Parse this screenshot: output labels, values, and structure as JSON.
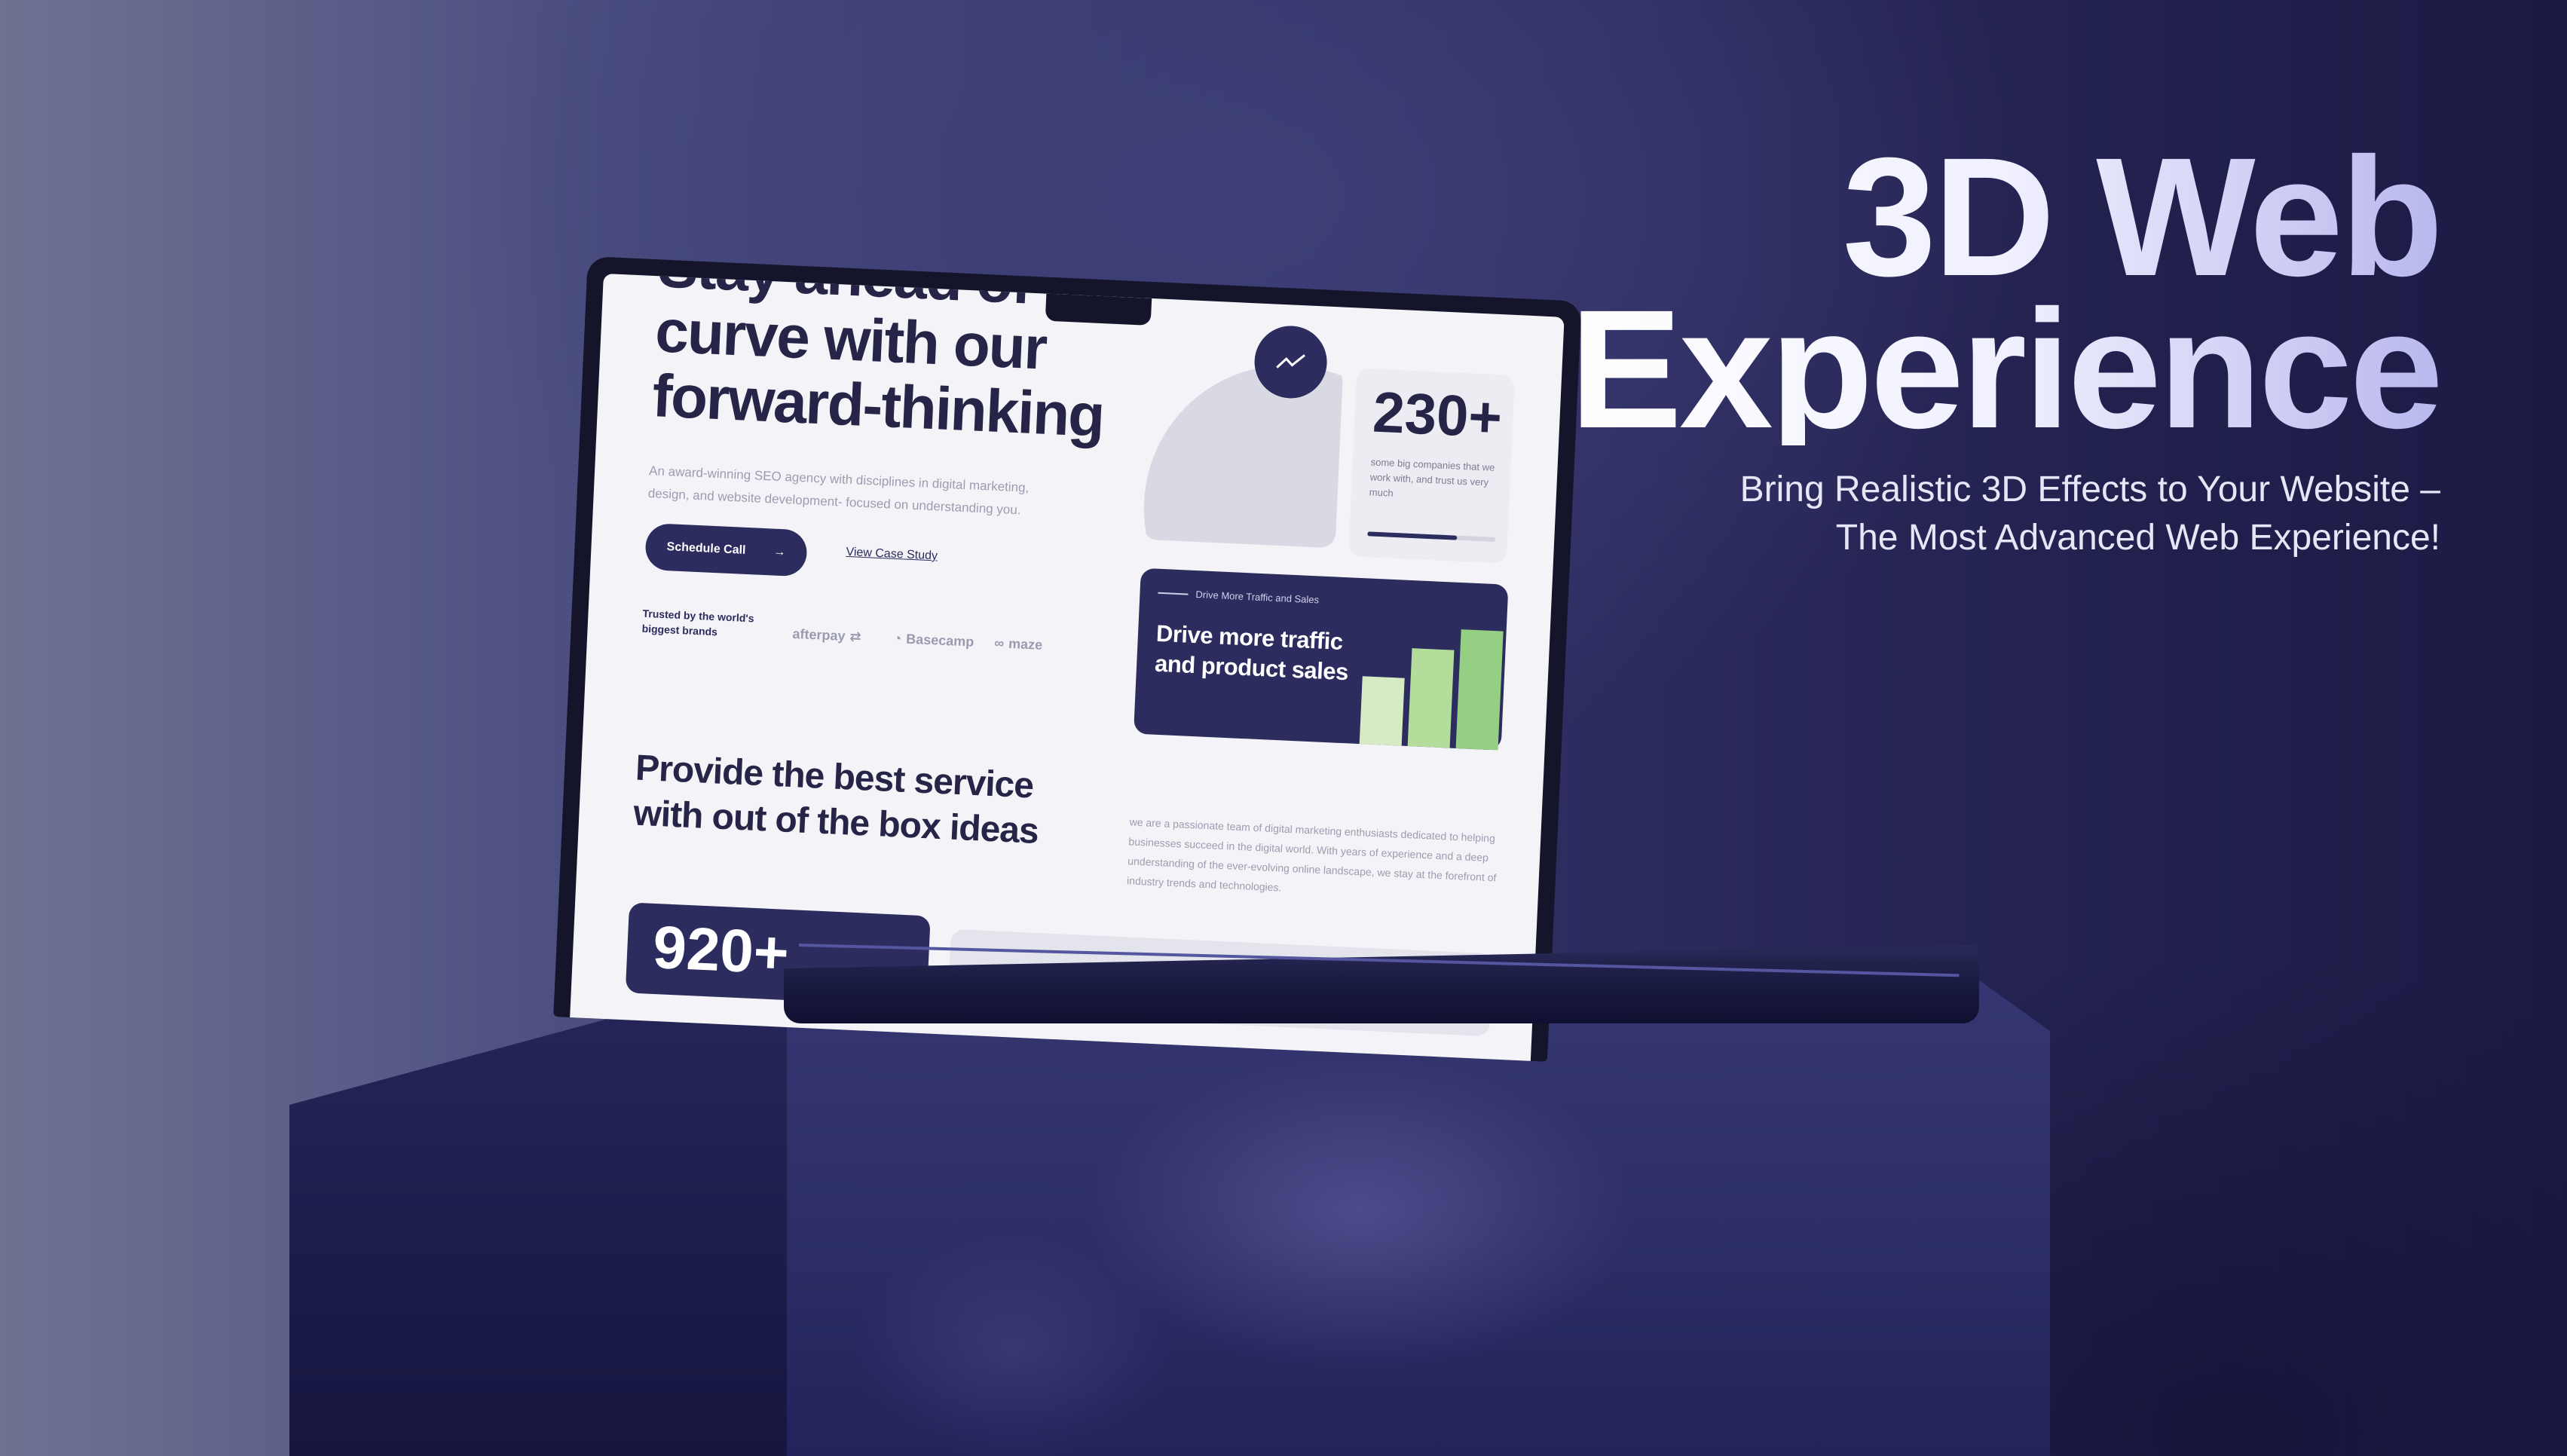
{
  "hero": {
    "title_line1": "3D Web",
    "title_line2": "Experience",
    "subtitle_line1": "Bring Realistic 3D Effects to Your Website –",
    "subtitle_line2": "The Most Advanced Web Experience!"
  },
  "screen": {
    "heading_line1": "Stay ahead of the",
    "heading_line2": "curve with our",
    "heading_line3": "forward-thinking",
    "description": "An award-winning SEO agency with disciplines in digital marketing, design, and website development- focused on understanding you.",
    "primary_button": "Schedule Call",
    "primary_button_icon": "arrow-right-icon",
    "secondary_link": "View Case Study",
    "trusted_text": "Trusted by the world's biggest brands",
    "brands": [
      "afterpay",
      "Basecamp",
      "maze"
    ],
    "section_heading": "Provide the best service with out of the box ideas",
    "section_paragraph": "we are a passionate team of digital marketing enthusiasts dedicated to helping businesses succeed in the digital world. With years of experience and a deep understanding of the ever-evolving online landscape, we stay at the forefront of industry trends and technologies.",
    "stat_card_number": "920+",
    "count_card": {
      "number": "230+",
      "caption": "some big companies that we work with, and trust us very much",
      "progress": 0.7
    },
    "traffic_card": {
      "tag": "Drive More Traffic and Sales",
      "title": "Drive more traffic and product sales",
      "bar_levels": [
        0.5,
        0.72,
        0.88
      ],
      "bar_colors": [
        "#d6ebc4",
        "#b4dd9c",
        "#95cf83"
      ]
    },
    "trend_icon": "trend-up-icon"
  },
  "colors": {
    "accent_navy": "#2c2c5e",
    "green": "#95cf83",
    "background": "#2a2a5e"
  }
}
